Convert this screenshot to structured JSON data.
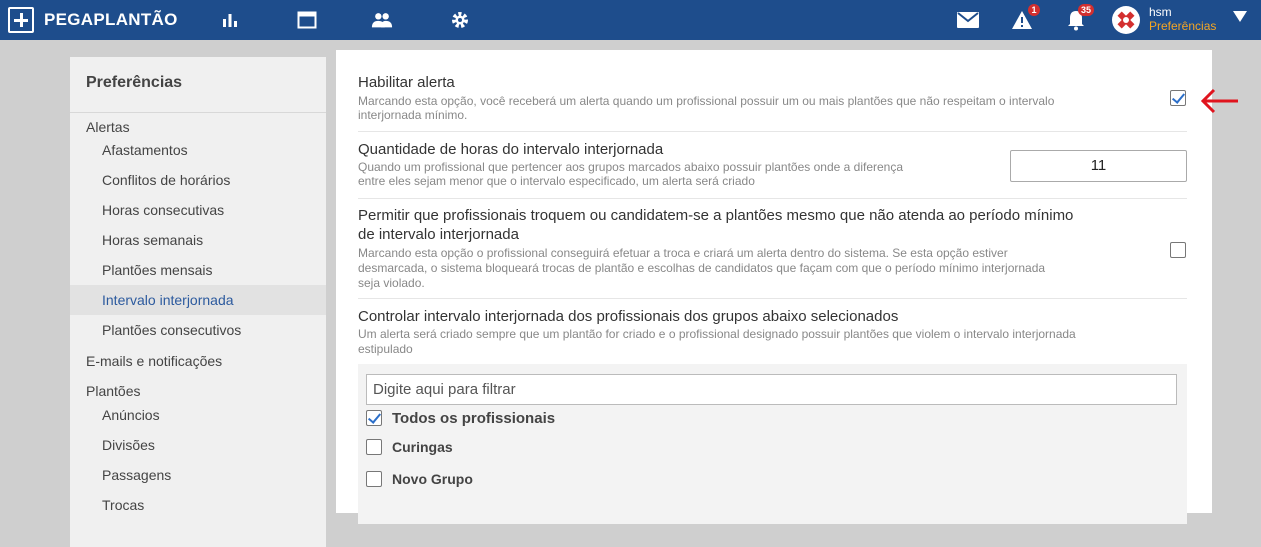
{
  "app": {
    "brand": "PEGAPLANTÃO",
    "nav_icons": [
      "bar-chart-icon",
      "window-icon",
      "people-icon",
      "gear-icon"
    ],
    "notifications": {
      "alerts_count": "1",
      "bell_count": "35"
    },
    "user": {
      "name": "hsm",
      "subtitle": "Preferências"
    }
  },
  "sidebar": {
    "title": "Preferências",
    "items": [
      {
        "label": "Alertas",
        "type": "group"
      },
      {
        "label": "Afastamentos",
        "type": "sub"
      },
      {
        "label": "Conflitos de horários",
        "type": "sub"
      },
      {
        "label": "Horas consecutivas",
        "type": "sub"
      },
      {
        "label": "Horas semanais",
        "type": "sub"
      },
      {
        "label": "Plantões mensais",
        "type": "sub"
      },
      {
        "label": "Intervalo interjornada",
        "type": "sub",
        "active": true
      },
      {
        "label": "Plantões consecutivos",
        "type": "sub"
      },
      {
        "label": "E-mails e notificações",
        "type": "group"
      },
      {
        "label": "Plantões",
        "type": "group"
      },
      {
        "label": "Anúncios",
        "type": "sub"
      },
      {
        "label": "Divisões",
        "type": "sub"
      },
      {
        "label": "Passagens",
        "type": "sub"
      },
      {
        "label": "Trocas",
        "type": "sub"
      }
    ]
  },
  "settings": {
    "enable_alert": {
      "title": "Habilitar alerta",
      "desc_line1": "Marcando esta opção, você receberá um alerta quando um profissional possuir um ou mais plantões que não respeitam o intervalo",
      "desc_line2": "interjornada mínimo.",
      "checked": true
    },
    "hours": {
      "title": "Quantidade de horas do intervalo interjornada",
      "desc_line1": "Quando um profissional que pertencer aos grupos marcados abaixo possuir plantões onde a diferença",
      "desc_line2": "entre eles sejam menor que o intervalo especificado, um alerta será criado",
      "value": "11"
    },
    "allow_swap": {
      "title_line1": "Permitir que profissionais troquem ou candidatem-se a plantões mesmo que não atenda ao período mínimo",
      "title_line2": "de intervalo interjornada",
      "desc_line1": "Marcando esta opção o profissional conseguirá efetuar a troca e criará um alerta dentro do sistema. Se esta opção estiver",
      "desc_line2": "desmarcada, o sistema bloqueará trocas de plantão e escolhas de candidatos que façam com que o período mínimo interjornada",
      "desc_line3": "seja violado.",
      "checked": false
    },
    "control": {
      "title": "Controlar intervalo interjornada dos profissionais dos grupos abaixo selecionados",
      "desc_line1": "Um alerta será criado sempre que um plantão for criado e o profissional designado possuir plantões que violem o intervalo interjornada",
      "desc_line2": "estipulado",
      "filter_placeholder": "Digite aqui para filtrar",
      "groups": [
        {
          "label": "Todos os profissionais",
          "checked": true
        },
        {
          "label": "Curingas",
          "checked": false
        },
        {
          "label": "Novo Grupo",
          "checked": false
        }
      ]
    }
  },
  "colors": {
    "topbar": "#1e4d8c",
    "accent": "#2c6fc9",
    "badge": "#d32f2f",
    "user_sub": "#f5a623",
    "annotation": "#e0141e"
  }
}
